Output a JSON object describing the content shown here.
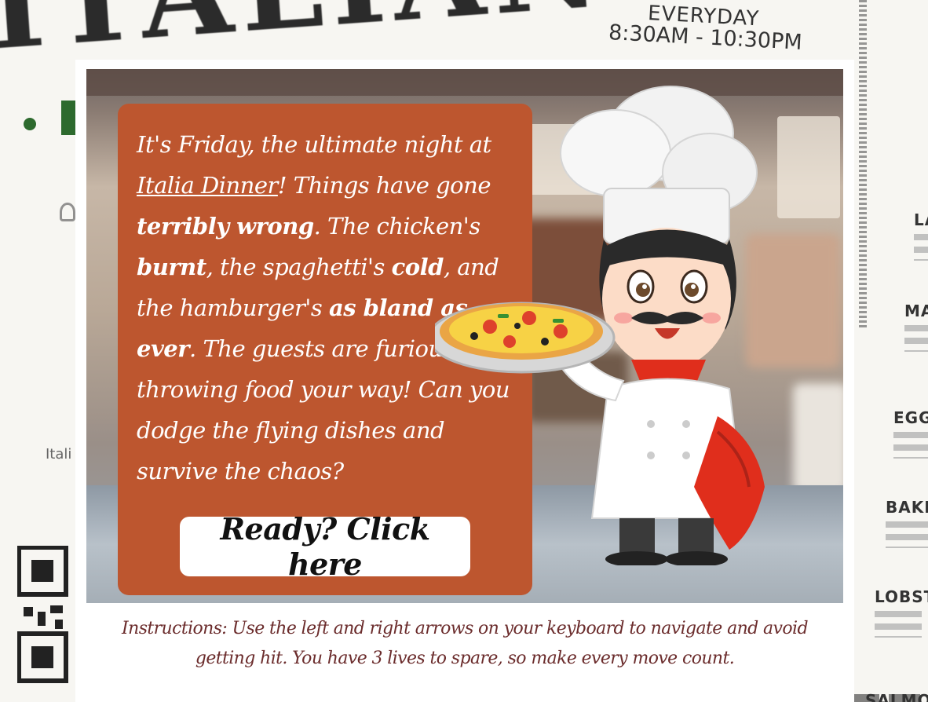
{
  "background_menu": {
    "title": "ITALIAN",
    "hours_label": "EVERYDAY",
    "hours_time": "8:30AM - 10:30PM",
    "side_text": "Itali",
    "items": [
      {
        "name": "LA"
      },
      {
        "name": "MA"
      },
      {
        "name": "EGG"
      },
      {
        "name": "BAKE"
      },
      {
        "name": "LOBST"
      },
      {
        "name": "SALMO"
      }
    ],
    "colors": {
      "accent_green": "#2d6a2e",
      "text_dark": "#2b2b2b"
    }
  },
  "story": {
    "p1": "It's Friday, the ultimate night at ",
    "brand": "Italia Dinner",
    "p2": "! Things have gone ",
    "h1": "terribly wrong",
    "p3": ". The chicken's ",
    "h2": "burnt",
    "p4": ", the spaghetti's ",
    "h3": "cold",
    "p5": ", and the hamburger's ",
    "h4": "as bland as ever",
    "p6": ". The guests are furious, throwing food your way! Can you dodge the flying dishes and survive the chaos?",
    "card_color": "#b95732"
  },
  "button": {
    "label": "Ready? Click here"
  },
  "instructions": {
    "line1": "Instructions: Use the left and right arrows on your keyboard to navigate and avoid",
    "line2": "getting hit. You have 3 lives to spare, so make every move count.",
    "color": "#6b2c2c"
  },
  "icons": {
    "chef": "chef-holding-pizza-illustration",
    "qr": "qr-code-icon",
    "ornament": "ornament-icon"
  }
}
